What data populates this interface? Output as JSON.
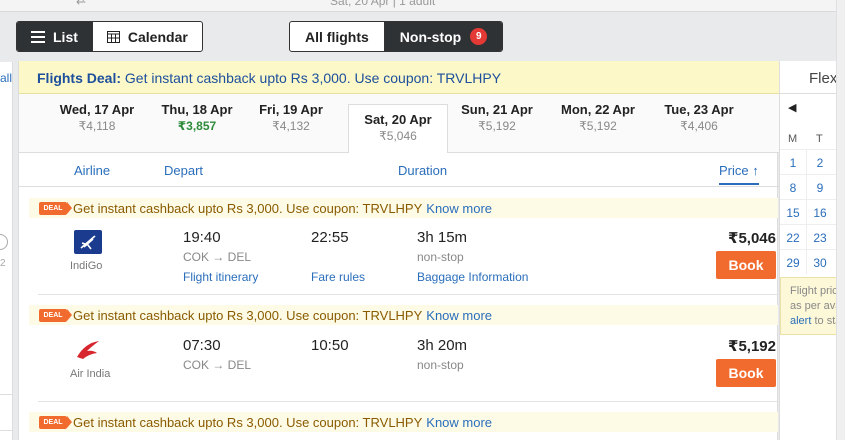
{
  "topstrip": {
    "text": "Sat, 20 Apr | 1 adult",
    "arrow": "⇄"
  },
  "view_toggle": {
    "list": "List",
    "calendar": "Calendar"
  },
  "stop_filter": {
    "all": "All flights",
    "nonstop": "Non-stop",
    "count": "9"
  },
  "left_panel": {
    "all_link": "all",
    "tick": "2"
  },
  "deal_banner": {
    "title": "Flights Deal:",
    "text": "Get instant cashback upto Rs 3,000. Use coupon: TRVLHPY"
  },
  "dates": [
    {
      "day": "Wed, 17 Apr",
      "price": "₹4,118"
    },
    {
      "day": "Thu, 18 Apr",
      "price": "₹3,857"
    },
    {
      "day": "Fri, 19 Apr",
      "price": "₹4,132"
    },
    {
      "day": "Sat, 20 Apr",
      "price": "₹5,046"
    },
    {
      "day": "Sun, 21 Apr",
      "price": "₹5,192"
    },
    {
      "day": "Mon, 22 Apr",
      "price": "₹5,192"
    },
    {
      "day": "Tue, 23 Apr",
      "price": "₹4,406"
    }
  ],
  "sort": {
    "airline": "Airline",
    "depart": "Depart",
    "duration": "Duration",
    "price": "Price ↑"
  },
  "deal_tag": "DEAL",
  "card_deal": {
    "text": "Get instant cashback upto Rs 3,000. Use coupon: TRVLHPY",
    "link": "Know more"
  },
  "flights": [
    {
      "airline": "IndiGo",
      "depart": "19:40",
      "route": "COK → DEL",
      "arrive": "22:55",
      "duration": "3h 15m",
      "stops": "non-stop",
      "price": "5,046",
      "book": "Book",
      "links": {
        "itinerary": "Flight itinerary",
        "fare_rules": "Fare rules",
        "baggage": "Baggage Information"
      }
    },
    {
      "airline": "Air India",
      "depart": "07:30",
      "route": "COK → DEL",
      "arrive": "10:50",
      "duration": "3h 20m",
      "stops": "non-stop",
      "price": "5,192",
      "book": "Book"
    }
  ],
  "currency": "₹",
  "right_panel": {
    "title": "Flexible",
    "prev": "◀",
    "weekdays": [
      "M",
      "T"
    ],
    "rows": [
      [
        "1",
        "2"
      ],
      [
        "8",
        "9"
      ],
      [
        "15",
        "16"
      ],
      [
        "22",
        "23"
      ],
      [
        "29",
        "30"
      ]
    ],
    "note_line1": "Flight prices",
    "note_line2": "as per availability",
    "note_link": "alert",
    "note_line3": " to stay"
  },
  "colors": {
    "accent": "#f26b2e",
    "link": "#2a6ebb",
    "deal_bg": "#fdf8c8",
    "badge": "#e53935",
    "cheap": "#2e8b3a"
  }
}
